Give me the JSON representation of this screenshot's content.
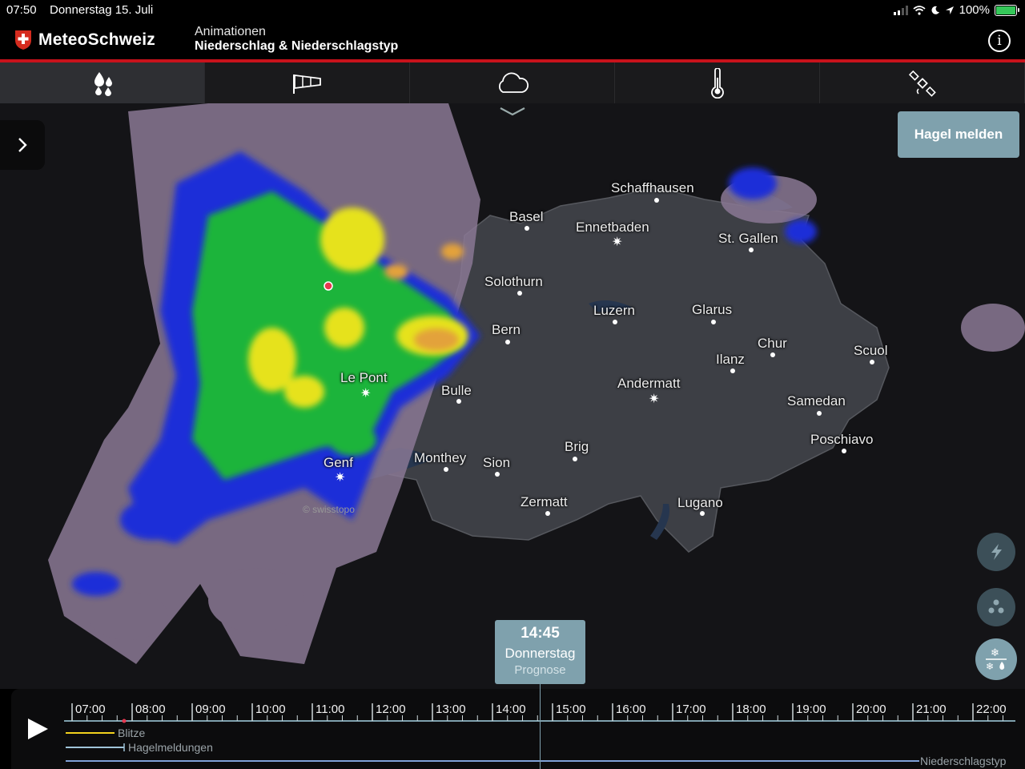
{
  "status": {
    "time": "07:50",
    "date": "Donnerstag 15. Juli",
    "battery": "100%"
  },
  "header": {
    "brand": "MeteoSchweiz",
    "title_line1": "Animationen",
    "title_line2": "Niederschlag & Niederschlagstyp"
  },
  "tabs": [
    {
      "icon": "precipitation-icon",
      "active": true
    },
    {
      "icon": "windsock-icon",
      "active": false
    },
    {
      "icon": "cloud-icon",
      "active": false
    },
    {
      "icon": "thermometer-icon",
      "active": false
    },
    {
      "icon": "satellite-icon",
      "active": false
    }
  ],
  "map": {
    "hail_button": "Hagel melden",
    "copyright": "© swisstopo",
    "cities": [
      "Schaffhausen",
      "Basel",
      "Ennetbaden",
      "St. Gallen",
      "Solothurn",
      "Luzern",
      "Glarus",
      "Bern",
      "Chur",
      "Scuol",
      "Ilanz",
      "Le Pont",
      "Bulle",
      "Andermatt",
      "Samedan",
      "Poschiavo",
      "Brig",
      "Genf",
      "Monthey",
      "Sion",
      "Zermatt",
      "Lugano"
    ]
  },
  "time_label": {
    "time": "14:45",
    "day": "Donnerstag",
    "type": "Prognose"
  },
  "timeline": {
    "ticks": [
      "07:00",
      "08:00",
      "09:00",
      "10:00",
      "11:00",
      "12:00",
      "13:00",
      "14:00",
      "15:00",
      "16:00",
      "17:00",
      "18:00",
      "19:00",
      "20:00",
      "21:00",
      "22:00"
    ],
    "legend_lightning": "Blitze",
    "legend_hail": "Hagelmeldungen",
    "legend_type": "Niederschlagstyp"
  },
  "colors": {
    "accent": "#7fa1ad",
    "brand_red": "#c8121b",
    "lightning": "#f2d11d",
    "hail": "#9fc4d8",
    "type_line": "#7fa1d8"
  }
}
